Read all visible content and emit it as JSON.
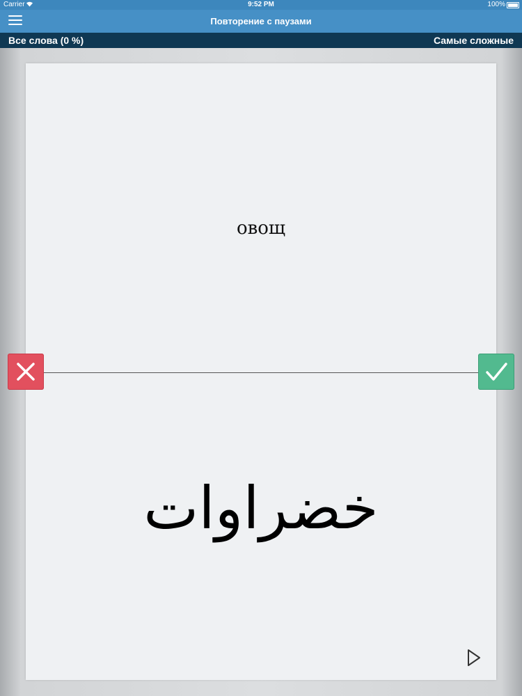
{
  "statusbar": {
    "carrier": "Carrier",
    "time": "9:52 PM",
    "battery": "100%"
  },
  "navbar": {
    "title": "Повторение с паузами",
    "menu_icon": "hamburger-menu-icon"
  },
  "filterbar": {
    "left_label": "Все слова (0 %)",
    "right_label": "Самые сложные"
  },
  "card": {
    "word": "овощ",
    "translation": "خضراوات"
  },
  "buttons": {
    "wrong_icon": "cross-icon",
    "right_icon": "check-icon",
    "play_icon": "play-icon"
  },
  "colors": {
    "statusbar": "#3d87bd",
    "navbar": "#4690c6",
    "filterbar": "#0f3853",
    "wrong": "#e2505e",
    "right": "#52ba8f",
    "card": "#eff1f3"
  }
}
